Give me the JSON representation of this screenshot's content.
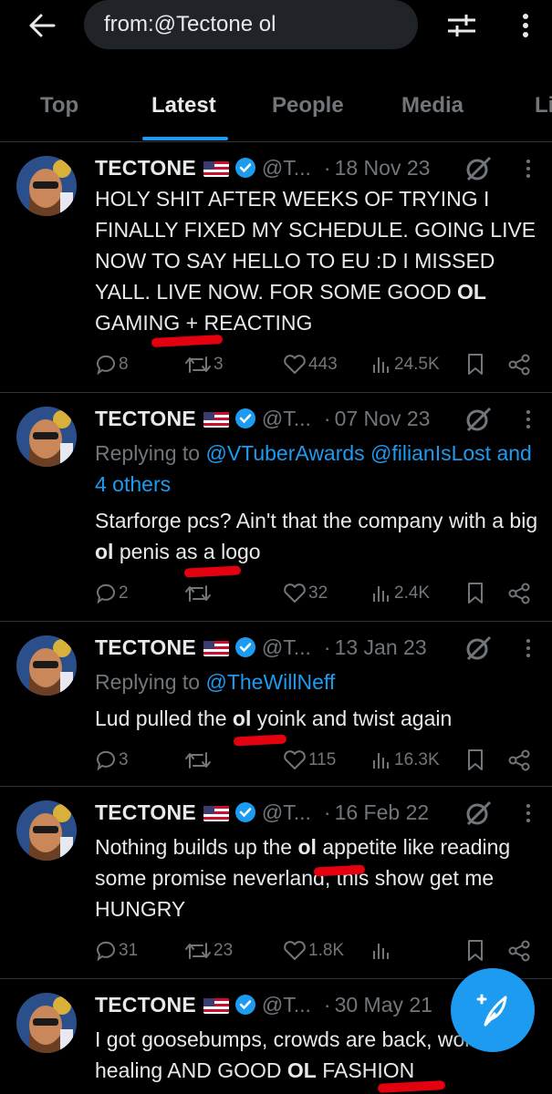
{
  "search": {
    "query": "from:@Tectone ol"
  },
  "icons": {
    "back": "arrow-left-icon",
    "filter": "filter-sliders-icon",
    "more": "more-vertical-icon",
    "compose": "compose-feather-icon"
  },
  "tabs": [
    {
      "label": "Top"
    },
    {
      "label": "Latest",
      "active": true
    },
    {
      "label": "People"
    },
    {
      "label": "Media"
    },
    {
      "label": "Li"
    }
  ],
  "colors": {
    "accent": "#1d9bf0",
    "muted": "#71767b",
    "highlight": "#e3000f",
    "background": "#000000"
  },
  "tweets": [
    {
      "name": "TECTONE",
      "handle": "@T...",
      "date": "18 Nov 23",
      "body_parts": [
        "HOLY SHIT AFTER WEEKS OF TRYING I FINALLY FIXED MY SCHEDULE. GOING LIVE NOW TO SAY HELLO TO EU :D I MISSED YALL. LIVE NOW. FOR SOME GOOD ",
        "OL",
        " GAMING + REACTING"
      ],
      "replies": "8",
      "reposts": "3",
      "likes": "443",
      "views": "24.5K"
    },
    {
      "name": "TECTONE",
      "handle": "@T...",
      "date": "07 Nov 23",
      "reply_prefix": "Replying to ",
      "reply_to": "@VTuberAwards @filianIsLost and 4 others",
      "body_parts": [
        "Starforge pcs? Ain't that the company with a big ",
        "ol",
        " penis as a logo"
      ],
      "replies": "2",
      "reposts": "",
      "likes": "32",
      "views": "2.4K"
    },
    {
      "name": "TECTONE",
      "handle": "@T...",
      "date": "13 Jan 23",
      "reply_prefix": "Replying to ",
      "reply_to": "@TheWillNeff",
      "body_parts": [
        "Lud pulled the ",
        "ol",
        " yoink and twist again"
      ],
      "replies": "3",
      "reposts": "",
      "likes": "115",
      "views": "16.3K"
    },
    {
      "name": "TECTONE",
      "handle": "@T...",
      "date": "16 Feb 22",
      "body_parts": [
        "Nothing builds up the ",
        "ol",
        " appetite like reading some promise neverland, this show get me HUNGRY"
      ],
      "replies": "31",
      "reposts": "23",
      "likes": "1.8K",
      "views": ""
    },
    {
      "name": "TECTONE",
      "handle": "@T...",
      "date": "30 May 21",
      "body_parts": [
        "I got goosebumps, crowds are back, world is healing AND GOOD ",
        "OL",
        " FASHION"
      ],
      "replies": "",
      "reposts": "",
      "likes": "",
      "views": ""
    }
  ]
}
